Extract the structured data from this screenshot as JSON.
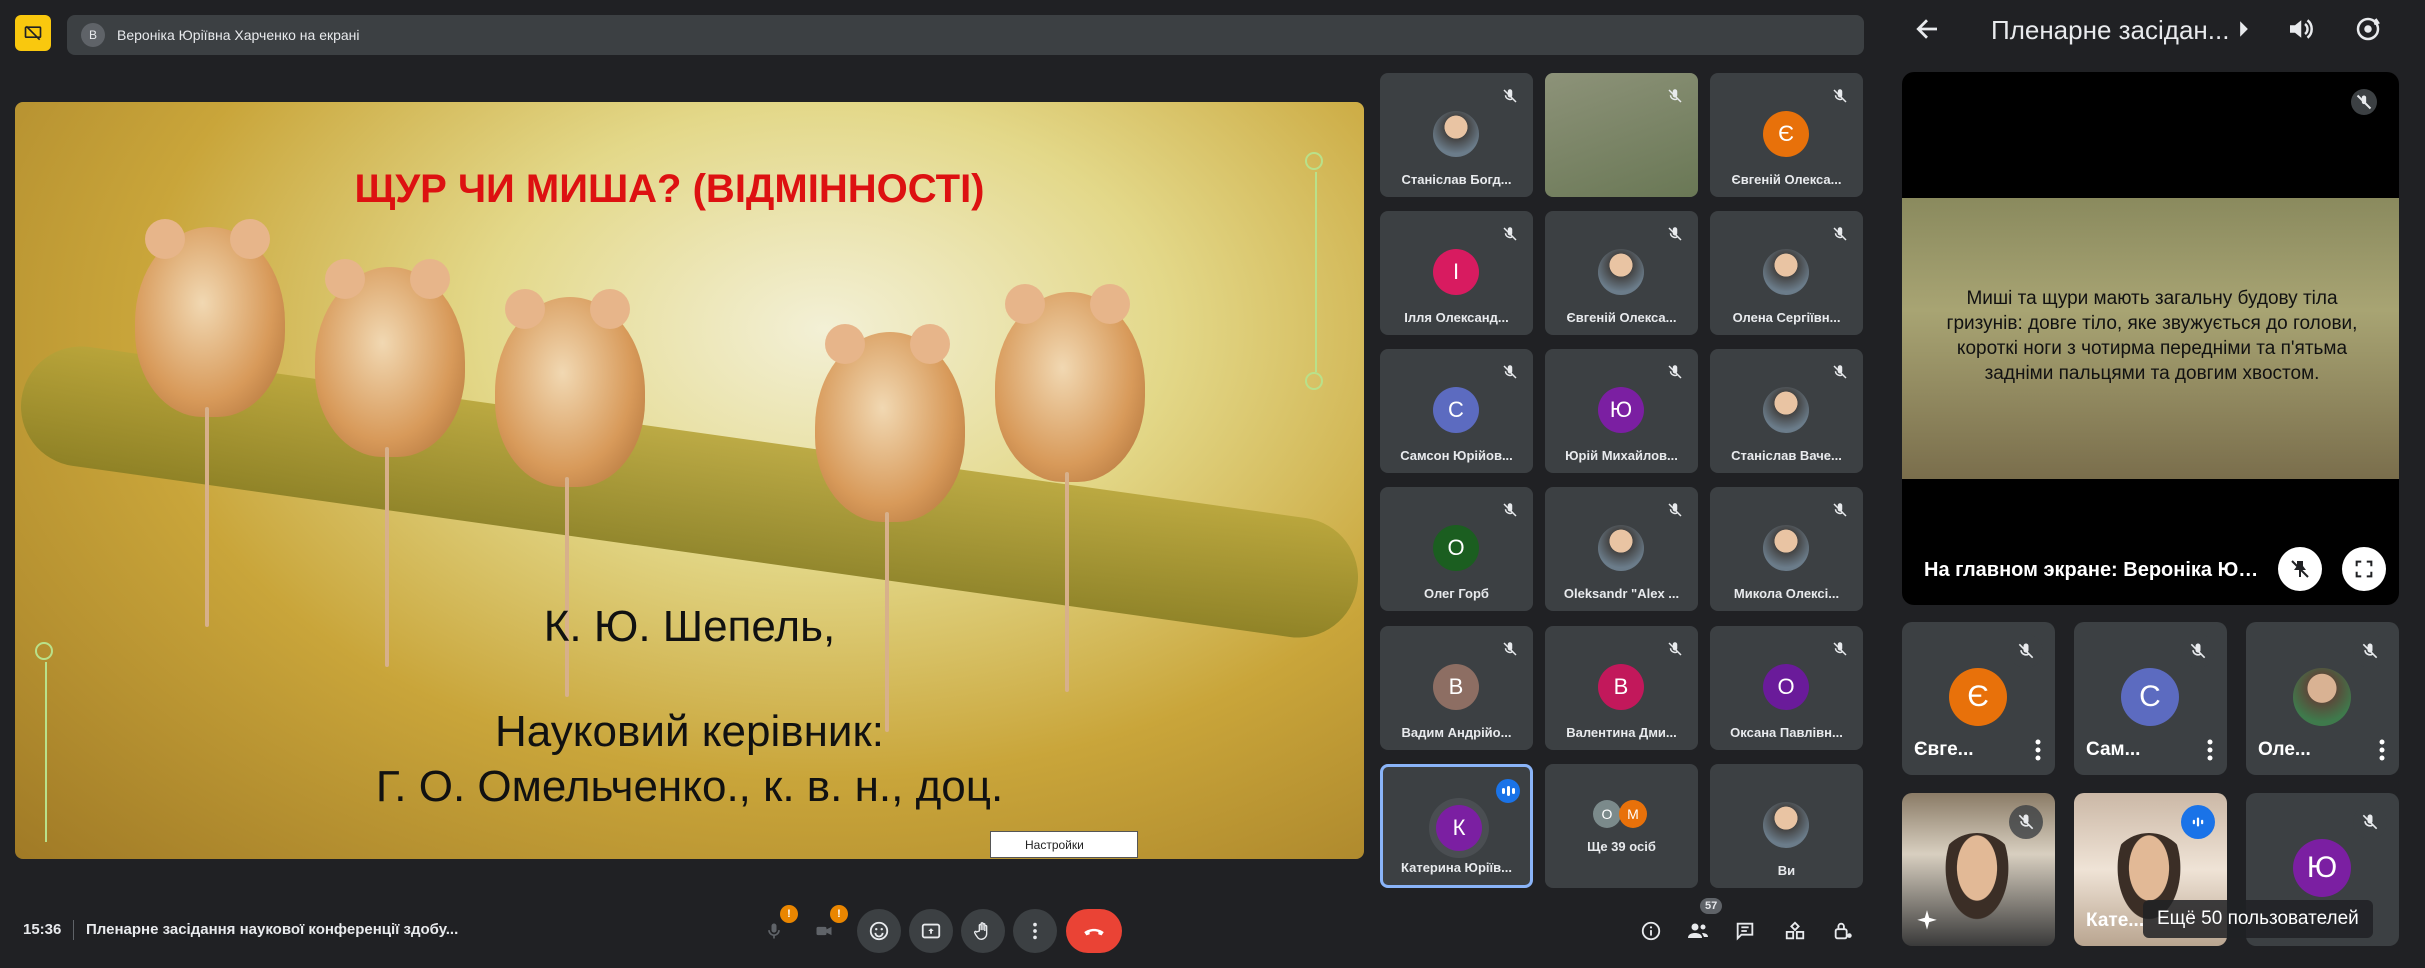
{
  "header": {
    "presenter_initial": "В",
    "presenter_text": "Вероніка Юріївна Харченко на екрані"
  },
  "slide": {
    "title": "ЩУР ЧИ МИША? (ВІДМІННОСТІ)",
    "author": "К. Ю. Шепель,",
    "supervisor_label": "Науковий керівник:",
    "supervisor_name": "Г. О. Омельченко., к. в. н., доц.",
    "settings_label": "Настройки"
  },
  "tiles": [
    {
      "name": "Станіслав Богд...",
      "initial": "",
      "color": "",
      "photo": true
    },
    {
      "name": "",
      "initial": "",
      "color": "",
      "screen": true
    },
    {
      "name": "Євгеній Олекса...",
      "initial": "Є",
      "color": "#e8710a"
    },
    {
      "name": "Ілля Олександ...",
      "initial": "І",
      "color": "#d81b60"
    },
    {
      "name": "Євгеній Олекса...",
      "initial": "",
      "color": "",
      "photo": true
    },
    {
      "name": "Олена Сергіївн...",
      "initial": "",
      "color": "",
      "photo": true
    },
    {
      "name": "Самсон Юрійов...",
      "initial": "С",
      "color": "#5c6bc0"
    },
    {
      "name": "Юрій Михайлов...",
      "initial": "Ю",
      "color": "#7b1fa2"
    },
    {
      "name": "Станіслав Ваче...",
      "initial": "",
      "color": "",
      "photo": true
    },
    {
      "name": "Олег Горб",
      "initial": "О",
      "color": "#1b5e20"
    },
    {
      "name": "Oleksandr \"Alex ...",
      "initial": "",
      "color": "",
      "photo": true
    },
    {
      "name": "Микола Олексі...",
      "initial": "",
      "color": "",
      "photo": true
    },
    {
      "name": "Вадим Андрійо...",
      "initial": "В",
      "color": "#8d6e63"
    },
    {
      "name": "Валентина Дми...",
      "initial": "В",
      "color": "#c2185b"
    },
    {
      "name": "Оксана Павлівн...",
      "initial": "О",
      "color": "#6a1b9a"
    },
    {
      "name": "Катерина Юріїв...",
      "initial": "К",
      "color": "#7b1fa2",
      "active": true
    },
    {
      "name": "Ще 39 осіб",
      "initial": "",
      "color": ""
    },
    {
      "name": "Ви",
      "initial": "",
      "color": "",
      "photo": true
    }
  ],
  "more_people": {
    "a": "О",
    "b": "М"
  },
  "bottom": {
    "time": "15:36",
    "meeting_name": "Пленарне засідання наукової конференції здобу...",
    "mic_badge": "!",
    "cam_badge": "!",
    "people_count": "57"
  },
  "right_panel": {
    "title": "Пленарне засідан...",
    "main_text": "Миші та щури мають загальну будову тіла гризунів: довге тіло, яке звужується до голови, короткі ноги з чотирма передніми та п'ятьма задніми пальцями та довгим хвостом.",
    "main_caption": "На главном экране: Вероніка Юрі...",
    "participants": [
      {
        "name": "Євге...",
        "initial": "Є",
        "color": "#e8710a"
      },
      {
        "name": "Сам...",
        "initial": "С",
        "color": "#5c6bc0"
      },
      {
        "name": "Оле...",
        "initial": "",
        "color": "",
        "photo": true
      },
      {
        "name": "",
        "initial": "",
        "color": "",
        "photo": true
      },
      {
        "name": "Кате...",
        "initial": "",
        "color": "",
        "photo": true
      },
      {
        "name": "",
        "initial": "Ю",
        "color": "#7b1fa2"
      }
    ],
    "more_users": "Ещё 50 пользователей"
  }
}
